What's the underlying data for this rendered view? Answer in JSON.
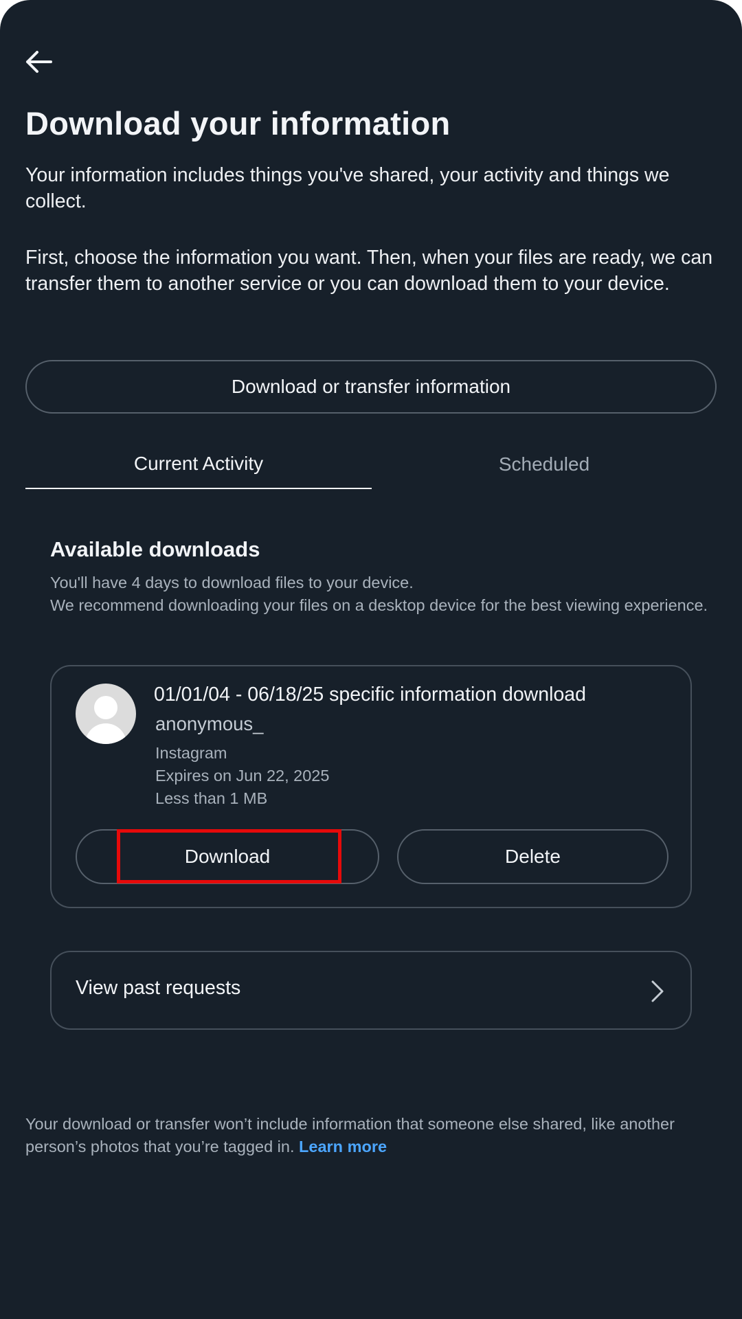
{
  "header": {
    "back_icon": "arrow-left-icon",
    "title": "Download your information"
  },
  "intro": {
    "paragraph_1": "Your information includes things you've shared, your activity and things we collect.",
    "paragraph_2": "First, choose the information you want. Then, when your files are ready, we can transfer them to another service or you can download them to your device."
  },
  "transfer_button": {
    "label": "Download or transfer information"
  },
  "tabs": [
    {
      "label": "Current Activity",
      "selected": true
    },
    {
      "label": "Scheduled",
      "selected": false
    }
  ],
  "available_downloads": {
    "title": "Available downloads",
    "note_1": "You'll have 4 days to download files to your device.",
    "note_2": "We recommend downloading your files on a desktop device for the best viewing experience.",
    "item": {
      "avatar_icon": "default-avatar-icon",
      "title": "01/01/04 - 06/18/25 specific information download",
      "username": "anonymous_",
      "source": "Instagram",
      "expires": "Expires on Jun 22, 2025",
      "size": "Less than 1 MB",
      "download_label": "Download",
      "delete_label": "Delete"
    }
  },
  "past_requests": {
    "label": "View past requests",
    "icon": "chevron-right-icon"
  },
  "footer": {
    "text": "Your download or transfer won’t include information that someone else shared, like another person’s photos that you’re tagged in.",
    "link": "Learn more"
  },
  "colors": {
    "background": "#17202a",
    "border": "#46505b",
    "link": "#4ca6ff",
    "highlight": "#e60a0a"
  }
}
